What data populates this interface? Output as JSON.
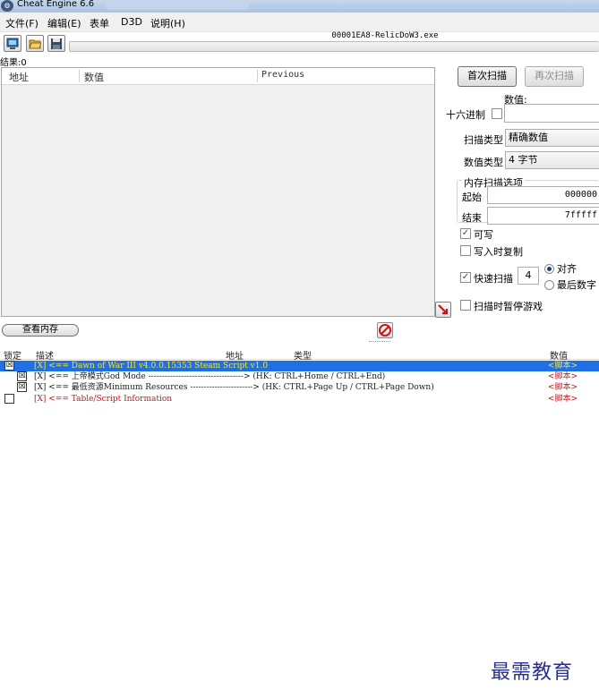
{
  "window": {
    "title": "Cheat Engine 6.6"
  },
  "menu": [
    "文件(F)",
    "编辑(E)",
    "表单",
    "D3D",
    "说明(H)"
  ],
  "process": {
    "name": "00001EA8-RelicDoW3.exe"
  },
  "results": {
    "label": "结果:0",
    "columns": [
      "地址",
      "数值",
      "Previous"
    ]
  },
  "scan": {
    "first_scan": "首次扫描",
    "next_scan": "再次扫描",
    "value_label": "数值:",
    "hex_label": "十六进制",
    "scan_type_label": "扫描类型",
    "scan_type_value": "精确数值",
    "value_type_label": "数值类型",
    "value_type_value": "4 字节",
    "memory_options_title": "内存扫描选项",
    "start_label": "起始",
    "start_value": "000000",
    "end_label": "结束",
    "end_value": "7fffff",
    "writable_label": "可写",
    "copy_on_write_label": "写入时复制",
    "fast_scan_label": "快速扫描",
    "fast_scan_value": "4",
    "align_label": "对齐",
    "last_digits_label": "最后数字",
    "pause_label": "扫描时暂停游戏"
  },
  "memory_view_button": "查看内存",
  "table": {
    "columns": [
      "锁定",
      "描述",
      "地址",
      "类型",
      "数值"
    ],
    "rows": [
      {
        "check": "☒",
        "desc": "[X] <== Dawn of War III v4.0.0.15353 Steam Script v1.0",
        "value": "<脚本>",
        "selected": true
      },
      {
        "check": "☒",
        "desc": "[X] <== 上帝模式God Mode -----------------------------------> (HK: CTRL+Home / CTRL+End)",
        "value": "<脚本>",
        "selected": false
      },
      {
        "check": "☒",
        "desc": "[X] <== 最低资源Minimum Resources -----------------------> (HK: CTRL+Page Up / CTRL+Page Down)",
        "value": "<脚本>",
        "selected": false
      },
      {
        "check": "",
        "desc": "[X] <== Table/Script Information",
        "value": "<脚本>",
        "selected": false
      }
    ]
  },
  "watermark": "最需教育"
}
